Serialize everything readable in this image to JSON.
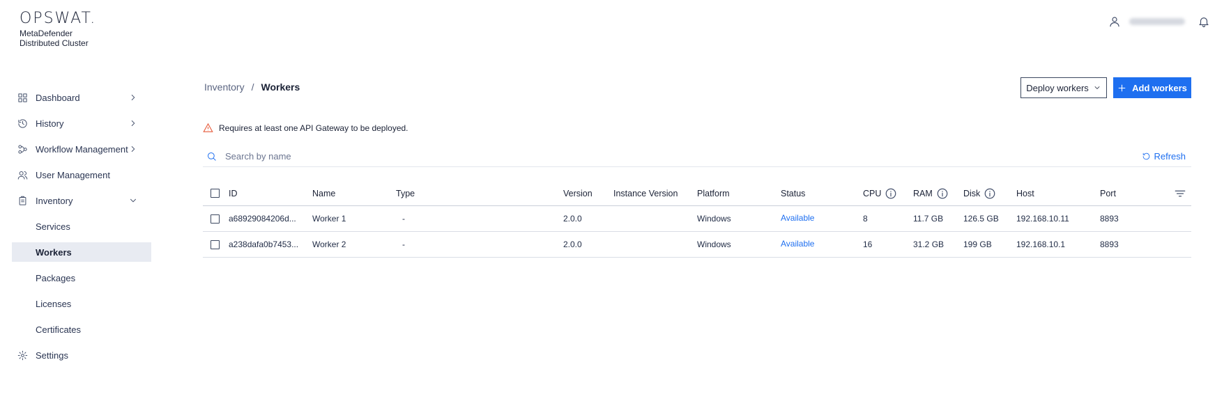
{
  "brand": {
    "logo": "OPSWAT.",
    "product_line1": "MetaDefender",
    "product_line2": "Distributed Cluster"
  },
  "header": {
    "user_icon": "user-icon",
    "bell_icon": "bell-icon"
  },
  "sidebar": {
    "items": [
      {
        "label": "Dashboard",
        "icon": "grid-icon",
        "expandable": true
      },
      {
        "label": "History",
        "icon": "history-icon",
        "expandable": true
      },
      {
        "label": "Workflow Management",
        "icon": "workflow-icon",
        "expandable": true
      },
      {
        "label": "User Management",
        "icon": "users-icon",
        "expandable": false
      },
      {
        "label": "Inventory",
        "icon": "clipboard-icon",
        "expandable": true,
        "expanded": true
      },
      {
        "label": "Settings",
        "icon": "gear-icon",
        "expandable": false
      }
    ],
    "inventory_sub": [
      "Services",
      "Workers",
      "Packages",
      "Licenses",
      "Certificates"
    ],
    "active_sub": "Workers"
  },
  "breadcrumb": {
    "root": "Inventory",
    "separator": "/",
    "current": "Workers"
  },
  "actions": {
    "deploy_label": "Deploy workers",
    "add_label": "Add workers"
  },
  "warning": {
    "text": "Requires at least one API Gateway to be deployed."
  },
  "search": {
    "placeholder": "Search by name",
    "refresh_label": "Refresh"
  },
  "table": {
    "columns": [
      "ID",
      "Name",
      "Type",
      "Version",
      "Instance Version",
      "Platform",
      "Status",
      "CPU",
      "RAM",
      "Disk",
      "Host",
      "Port"
    ],
    "rows": [
      {
        "id": "a68929084206d...",
        "name": "Worker 1",
        "type": "-",
        "version": "2.0.0",
        "instance_version": "",
        "platform": "Windows",
        "status": "Available",
        "cpu": "8",
        "ram": "11.7 GB",
        "disk": "126.5 GB",
        "host": "192.168.10.11",
        "port": "8893"
      },
      {
        "id": "a238dafa0b7453...",
        "name": "Worker 2",
        "type": "-",
        "version": "2.0.0",
        "instance_version": "",
        "platform": "Windows",
        "status": "Available",
        "cpu": "16",
        "ram": "31.2 GB",
        "disk": "199 GB",
        "host": "192.168.10.1",
        "port": "8893"
      }
    ]
  },
  "colors": {
    "accent": "#1e6ff0",
    "warning": "#e65a3a",
    "active_nav_bg": "#e8ebf2"
  }
}
